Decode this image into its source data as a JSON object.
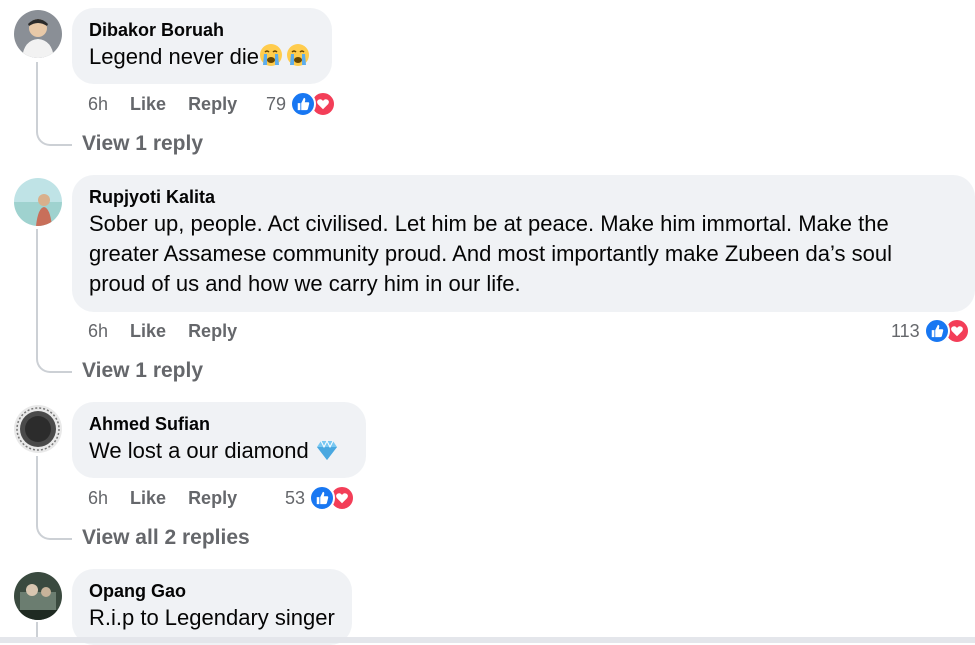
{
  "comments": [
    {
      "author": "Dibakor Boruah",
      "text": "Legend never die",
      "emojis": [
        "crying-face",
        "crying-face"
      ],
      "time": "6h",
      "like_label": "Like",
      "reply_label": "Reply",
      "reaction_count": "79",
      "view_replies": "View 1 reply"
    },
    {
      "author": "Rupjyoti Kalita",
      "text": "Sober up, people. Act civilised. Let him be at peace. Make him immortal. Make the greater Assamese community proud. And most importantly make Zubeen da’s soul proud of us and how we carry him in our life.",
      "time": "6h",
      "like_label": "Like",
      "reply_label": "Reply",
      "reaction_count": "113",
      "view_replies": "View 1 reply"
    },
    {
      "author": "Ahmed Sufian",
      "text": "We lost a our diamond",
      "emojis": [
        "gem"
      ],
      "time": "6h",
      "like_label": "Like",
      "reply_label": "Reply",
      "reaction_count": "53",
      "view_replies": "View all 2 replies"
    },
    {
      "author": "Opang Gao",
      "text": "R.i.p to Legendary singer"
    }
  ],
  "colors": {
    "bubble": "#f0f2f5",
    "meta_text": "#65676b",
    "like_blue": "#1877f2",
    "love_red": "#f33e58",
    "thread_line": "#ccd0d5"
  },
  "icons": [
    "like-reaction-icon",
    "love-reaction-icon",
    "crying-face-emoji",
    "gem-emoji"
  ]
}
